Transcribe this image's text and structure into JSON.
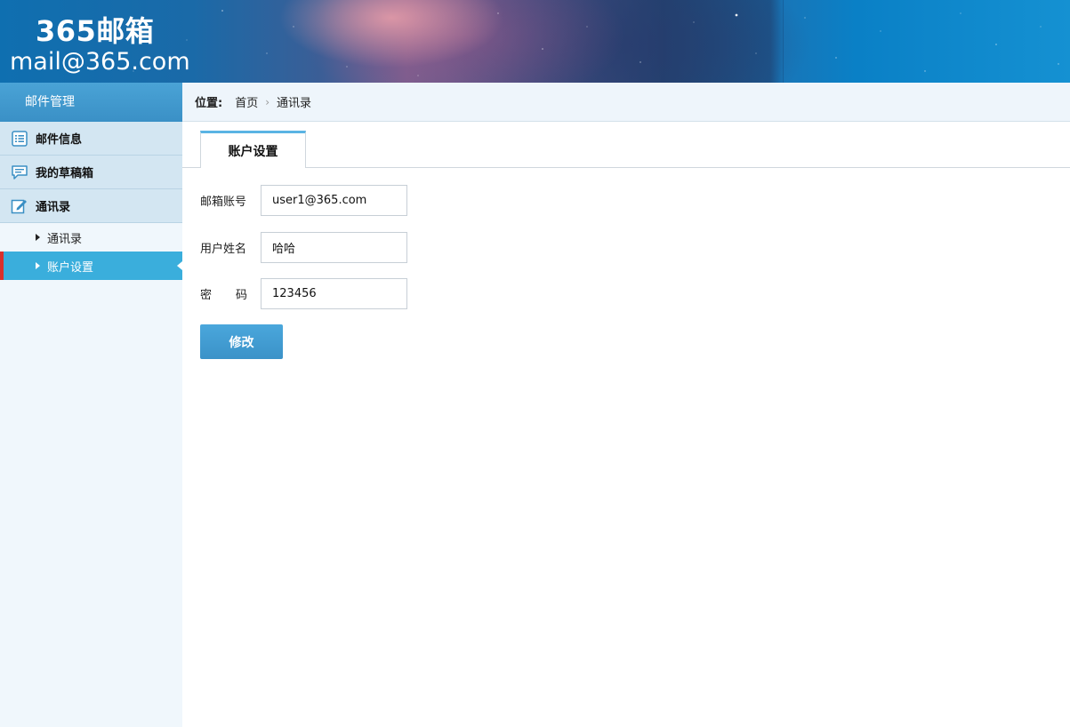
{
  "header": {
    "title": "365邮箱",
    "subtitle": "mail@365.com"
  },
  "sidebar": {
    "heading": "邮件管理",
    "items": [
      {
        "label": "邮件信息",
        "icon": "list-icon"
      },
      {
        "label": "我的草稿箱",
        "icon": "chat-bubble-icon"
      },
      {
        "label": "通讯录",
        "icon": "edit-icon"
      }
    ],
    "sub_items": [
      {
        "label": "通讯录",
        "active": false
      },
      {
        "label": "账户设置",
        "active": true
      }
    ]
  },
  "breadcrumb": {
    "label": "位置:",
    "items": [
      "首页",
      "通讯录"
    ],
    "separator": "›"
  },
  "main": {
    "tab_label": "账户设置",
    "form": {
      "email_label": "邮箱账号",
      "email_value": "user1@365.com",
      "name_label": "用户姓名",
      "name_value": "哈哈",
      "password_label_1": "密",
      "password_label_2": "码",
      "password_value": "123456",
      "submit_label": "修改"
    }
  },
  "colors": {
    "accent": "#3aaedc",
    "sidebar_head": "#3a90c6",
    "active_marker": "#d9302c",
    "tab_top": "#5ab4e4"
  }
}
